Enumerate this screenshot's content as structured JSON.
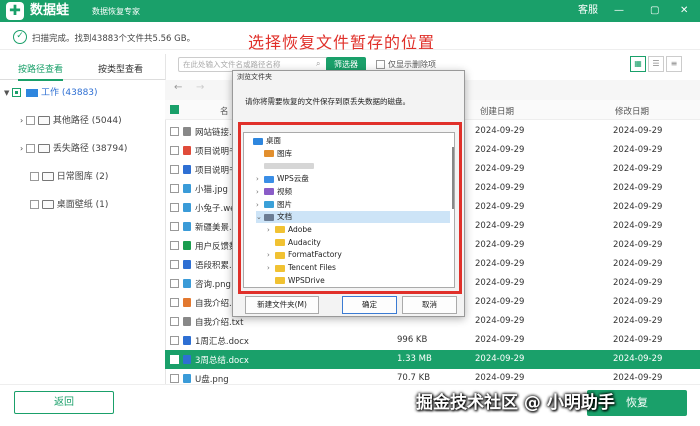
{
  "app": {
    "brand": "数据蛙",
    "subtitle": "数据恢复专家",
    "menu_service": "客服",
    "min": "—",
    "restore": "▢",
    "close": "✕"
  },
  "scan": {
    "status": "扫描完成。找到43883个文件共5.56 GB。"
  },
  "headline": "选择恢复文件暂存的位置",
  "tabs": [
    {
      "label": "按路径查看"
    },
    {
      "label": "按类型查看"
    }
  ],
  "sidebar": {
    "root": {
      "label": "工作 (43883)"
    },
    "items": [
      {
        "label": "其他路径 (5044)"
      },
      {
        "label": "丢失路径 (38794)"
      },
      {
        "label": "日常图库 (2)"
      },
      {
        "label": "桌面壁纸 (1)"
      }
    ]
  },
  "toolbar": {
    "search_placeholder": "在此处输入文件名或路径名称",
    "filter_label": "筛选器",
    "only_deleted": "仅显示删除项"
  },
  "table": {
    "headers": {
      "name": "名",
      "created": "创建日期",
      "modified": "修改日期"
    },
    "rows": [
      {
        "name": "网站链接.t",
        "size": "",
        "created": "2024-09-29",
        "modified": "2024-09-29",
        "icon": "txt",
        "checked": false
      },
      {
        "name": "项目说明书",
        "size": "",
        "created": "2024-09-29",
        "modified": "2024-09-29",
        "icon": "pdf",
        "checked": false
      },
      {
        "name": "项目说明书",
        "size": "",
        "created": "2024-09-29",
        "modified": "2024-09-29",
        "icon": "doc",
        "checked": false
      },
      {
        "name": "小猫.jpg",
        "size": "",
        "created": "2024-09-29",
        "modified": "2024-09-29",
        "icon": "img",
        "checked": false
      },
      {
        "name": "小兔子.web",
        "size": "",
        "created": "2024-09-29",
        "modified": "2024-09-29",
        "icon": "img",
        "checked": false
      },
      {
        "name": "新疆美景.w",
        "size": "",
        "created": "2024-09-29",
        "modified": "2024-09-29",
        "icon": "img",
        "checked": false
      },
      {
        "name": "用户反馈数",
        "size": "",
        "created": "2024-09-29",
        "modified": "2024-09-29",
        "icon": "xls",
        "checked": false
      },
      {
        "name": "语段积累.d",
        "size": "",
        "created": "2024-09-29",
        "modified": "2024-09-29",
        "icon": "doc",
        "checked": false
      },
      {
        "name": "咨询.png",
        "size": "",
        "created": "2024-09-29",
        "modified": "2024-09-29",
        "icon": "img",
        "checked": false
      },
      {
        "name": "自我介绍.pp",
        "size": "",
        "created": "2024-09-29",
        "modified": "2024-09-29",
        "icon": "ppt",
        "checked": false
      },
      {
        "name": "自我介绍.txt",
        "size": "",
        "created": "2024-09-29",
        "modified": "2024-09-29",
        "icon": "txt",
        "checked": false
      },
      {
        "name": "1周汇总.docx",
        "size": "996 KB",
        "created": "2024-09-29",
        "modified": "2024-09-29",
        "icon": "doc",
        "checked": false
      },
      {
        "name": "3周总结.docx",
        "size": "1.33 MB",
        "created": "2024-09-29",
        "modified": "2024-09-29",
        "icon": "doc",
        "checked": true
      },
      {
        "name": "U盘.png",
        "size": "70.7 KB",
        "created": "2024-09-29",
        "modified": "2024-09-29",
        "icon": "img",
        "checked": false
      }
    ]
  },
  "dialog": {
    "title": "浏览文件夹",
    "message": "请你将需要恢复的文件保存到原丢失数据的磁盘。",
    "tree": [
      {
        "label": "桌面",
        "indent": 0,
        "arrow": "",
        "icon": "desk"
      },
      {
        "label": "图库",
        "indent": 1,
        "arrow": "",
        "icon": "gallery"
      },
      {
        "label": "",
        "indent": 1,
        "arrow": "",
        "icon": "blur"
      },
      {
        "label": "WPS云盘",
        "indent": 1,
        "arrow": "›",
        "icon": "cloud"
      },
      {
        "label": "视频",
        "indent": 1,
        "arrow": "›",
        "icon": "video"
      },
      {
        "label": "图片",
        "indent": 1,
        "arrow": "›",
        "icon": "pic"
      },
      {
        "label": "文档",
        "indent": 1,
        "arrow": "⌄",
        "icon": "docs",
        "selected": true
      },
      {
        "label": "Adobe",
        "indent": 2,
        "arrow": "›",
        "icon": "folder"
      },
      {
        "label": "Audacity",
        "indent": 2,
        "arrow": "",
        "icon": "folder"
      },
      {
        "label": "FormatFactory",
        "indent": 2,
        "arrow": "›",
        "icon": "folder"
      },
      {
        "label": "Tencent Files",
        "indent": 2,
        "arrow": "›",
        "icon": "folder"
      },
      {
        "label": "WPSDrive",
        "indent": 2,
        "arrow": "",
        "icon": "folder"
      }
    ],
    "new_folder": "新建文件夹(M)",
    "ok": "确定",
    "cancel": "取消"
  },
  "bottom": {
    "back": "返回",
    "recover": "恢复"
  },
  "watermark": "掘金技术社区 @ 小明助手",
  "colors": {
    "accent": "#1aa06a",
    "headline": "#e0302a"
  }
}
